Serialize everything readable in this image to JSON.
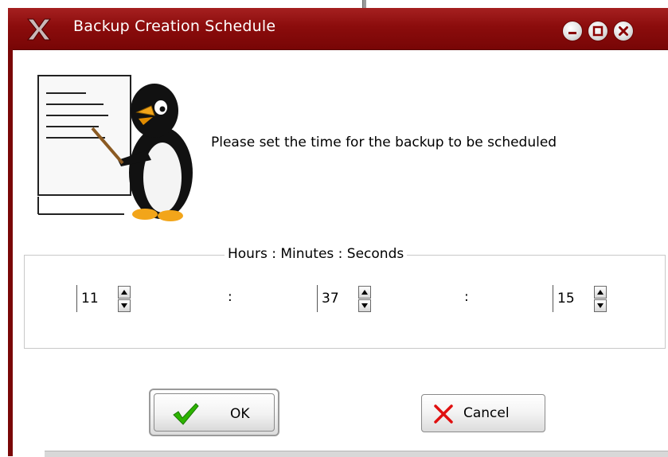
{
  "window": {
    "title": "Backup Creation Schedule"
  },
  "prompt": "Please set the time for the backup to be scheduled",
  "time_group": {
    "legend": "Hours : Minutes : Seconds",
    "hours": "11",
    "minutes": "37",
    "seconds": "15",
    "separator": ":"
  },
  "buttons": {
    "ok_label": "OK",
    "cancel_label": "Cancel"
  },
  "icons": {
    "window_logo": "x-logo-icon",
    "minimize": "minimize-icon",
    "maximize": "maximize-icon",
    "close": "close-icon",
    "mascot": "penguin-presenting-icon",
    "ok": "checkmark-icon",
    "cancel": "x-mark-icon"
  },
  "colors": {
    "titlebar": "#8b0c0c",
    "ok_check": "#2db400",
    "cancel_x": "#e01010"
  }
}
